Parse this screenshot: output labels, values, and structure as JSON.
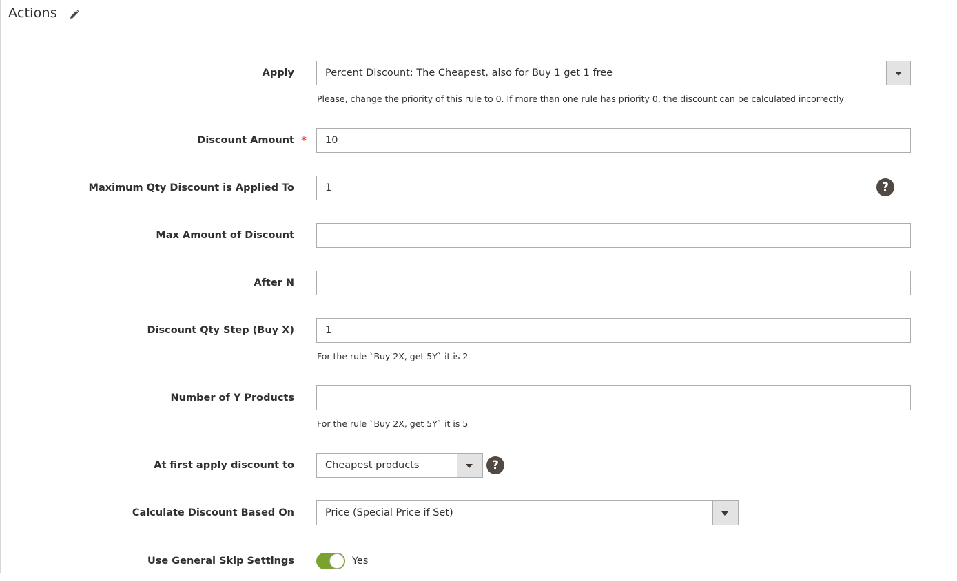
{
  "section": {
    "title": "Actions",
    "edit_icon": "pencil-icon"
  },
  "fields": {
    "apply": {
      "label": "Apply",
      "value": "Percent Discount: The Cheapest, also for Buy 1 get 1 free",
      "note": "Please, change the priority of this rule to 0. If more than one rule has priority 0, the discount can be calculated incorrectly"
    },
    "discount_amount": {
      "label": "Discount Amount",
      "required_mark": "*",
      "value": "10"
    },
    "max_qty": {
      "label": "Maximum Qty Discount is Applied To",
      "value": "1",
      "help": "?"
    },
    "max_amount": {
      "label": "Max Amount of Discount",
      "value": ""
    },
    "after_n": {
      "label": "After N",
      "value": ""
    },
    "qty_step": {
      "label": "Discount Qty Step (Buy X)",
      "value": "1",
      "note": "For the rule `Buy 2X, get 5Y` it is 2"
    },
    "y_products": {
      "label": "Number of Y Products",
      "value": "",
      "note": "For the rule `Buy 2X, get 5Y` it is 5"
    },
    "first_apply": {
      "label": "At first apply discount to",
      "value": "Cheapest products",
      "help": "?"
    },
    "calc_based_on": {
      "label": "Calculate Discount Based On",
      "value": "Price (Special Price if Set)"
    },
    "skip_settings": {
      "label": "Use General Skip Settings",
      "value": "Yes",
      "enabled": true
    }
  },
  "colors": {
    "toggle_on": "#79a22e",
    "required": "#e22626",
    "help_bg": "#514943"
  }
}
